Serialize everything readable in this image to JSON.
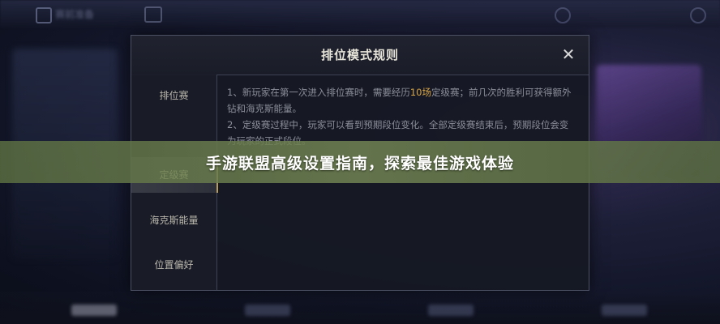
{
  "background": {
    "top_title": "赛前准备"
  },
  "dialog": {
    "title": "排位模式规则",
    "close_label": "✕",
    "nav": [
      {
        "label": "排位赛"
      },
      {
        "label": "定级赛"
      },
      {
        "label": "海克斯能量"
      },
      {
        "label": "位置偏好"
      }
    ],
    "content": {
      "line1_prefix": "1、新玩家在第一次进入排位赛时，需要经历",
      "line1_highlight": "10场",
      "line1_suffix": "定级赛；前几次的胜利可获得额外钻和海克斯能量。",
      "line2": "2、定级赛过程中，玩家可以看到预期段位变化。全部定级赛结束后，预期段位会变为玩家的正式段位。"
    }
  },
  "banner": {
    "text": "手游联盟高级设置指南，探索最佳游戏体验"
  },
  "colors": {
    "highlight": "#d9a646",
    "banner": "#6f8450",
    "dialog_bg": "#161923"
  }
}
